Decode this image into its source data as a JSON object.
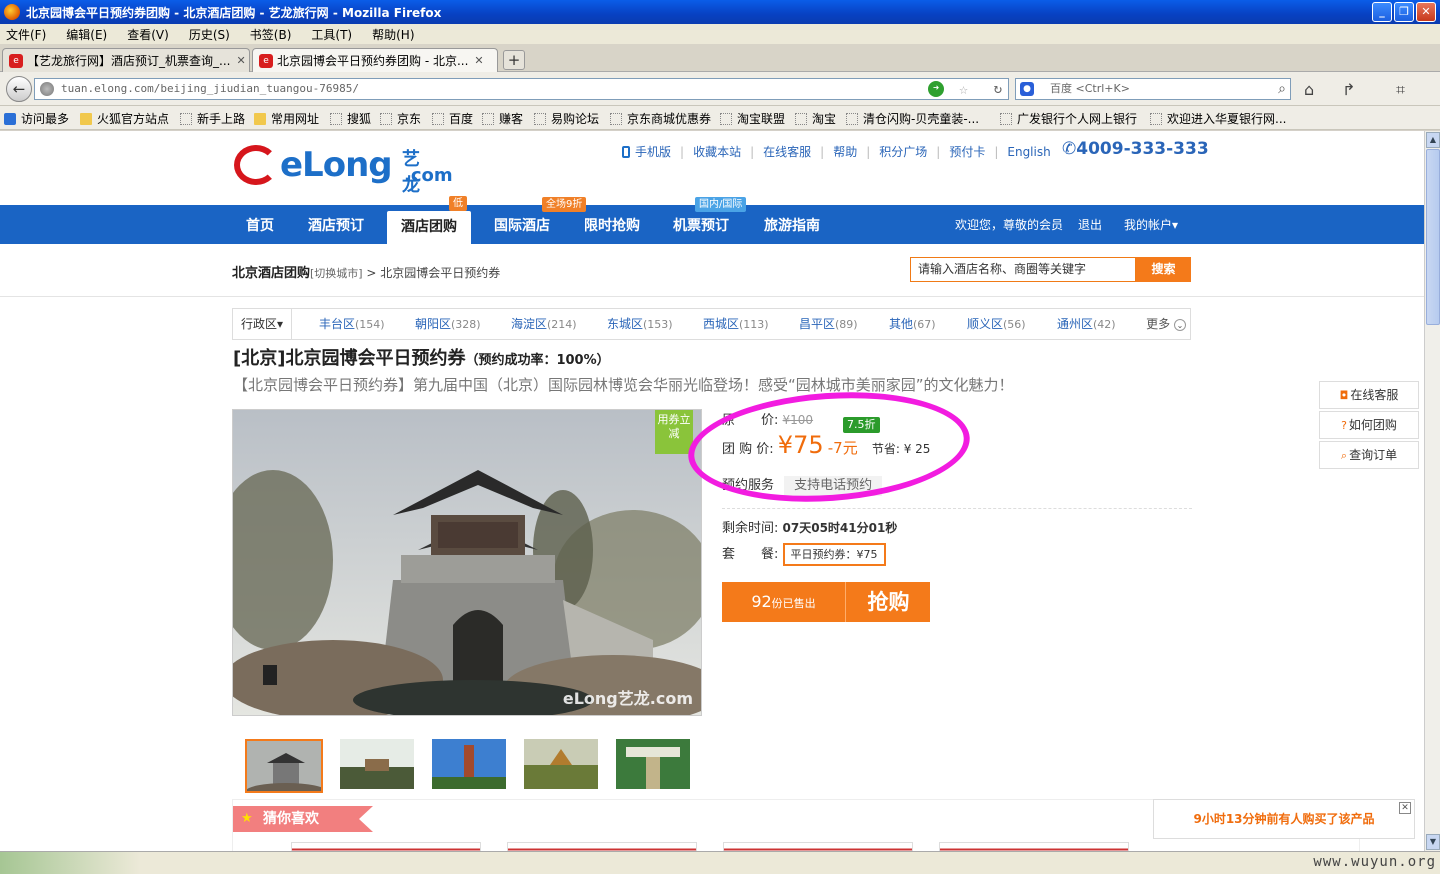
{
  "window": {
    "title": "北京园博会平日预约券团购 - 北京酒店团购 - 艺龙旅行网 - Mozilla Firefox",
    "minimize": "_",
    "restore": "❐",
    "close": "✕"
  },
  "menu": [
    "文件(F)",
    "编辑(E)",
    "查看(V)",
    "历史(S)",
    "书签(B)",
    "工具(T)",
    "帮助(H)"
  ],
  "tabs": [
    {
      "label": "【艺龙旅行网】酒店预订_机票查询_...",
      "active": false
    },
    {
      "label": "北京园博会平日预约券团购 - 北京...",
      "active": true
    }
  ],
  "tab_favicon": "e",
  "tab_close": "✕",
  "new_tab": "+",
  "address": {
    "url": "tuan.elong.com/beijing_jiudian_tuangou-76985/",
    "search_placeholder": "百度 <Ctrl+K>",
    "search_engine_icon": "paw-icon"
  },
  "bookmarks": [
    {
      "label": "访问最多",
      "icon": "blue"
    },
    {
      "label": "火狐官方站点",
      "icon": "folder"
    },
    {
      "label": "新手上路",
      "icon": "page"
    },
    {
      "label": "常用网址",
      "icon": "folder"
    },
    {
      "label": "搜狐",
      "icon": "page"
    },
    {
      "label": "京东",
      "icon": "page"
    },
    {
      "label": "百度",
      "icon": "page"
    },
    {
      "label": "赚客",
      "icon": "page"
    },
    {
      "label": "易购论坛",
      "icon": "page"
    },
    {
      "label": "京东商城优惠券",
      "icon": "page"
    },
    {
      "label": "淘宝联盟",
      "icon": "page"
    },
    {
      "label": "淘宝",
      "icon": "page"
    },
    {
      "label": "清仓闪购-贝壳童装-...",
      "icon": "page"
    },
    {
      "label": "广发银行个人网上银行",
      "icon": "page"
    },
    {
      "label": "欢迎进入华夏银行网...",
      "icon": "page"
    }
  ],
  "site": {
    "logo_text": "eLong",
    "logo_cn": "艺龙",
    "logo_com": ".com",
    "top_links": [
      "手机版",
      "收藏本站",
      "在线客服",
      "帮助",
      "积分广场",
      "预付卡",
      "English"
    ],
    "hotline": "4009-333-333",
    "nav": [
      {
        "label": "首页",
        "badge": ""
      },
      {
        "label": "酒店预订",
        "badge": ""
      },
      {
        "label": "酒店团购",
        "badge": "低",
        "active": true
      },
      {
        "label": "国际酒店",
        "badge": "全场9折"
      },
      {
        "label": "限时抢购",
        "badge": ""
      },
      {
        "label": "机票预订",
        "badge": "国内/国际"
      },
      {
        "label": "旅游指南",
        "badge": ""
      }
    ],
    "welcome": "欢迎您，尊敬的会员",
    "logout": "退出",
    "account": "我的帐户▾"
  },
  "breadcrumb": {
    "city": "北京酒店团购",
    "switch": "[切换城市]",
    "sep": " > ",
    "current": "北京园博会平日预约券"
  },
  "site_search": {
    "placeholder": "请输入酒店名称、商圈等关键字",
    "button": "搜索"
  },
  "districts": {
    "label": "行政区▾",
    "items": [
      {
        "name": "丰台区",
        "count": "(154)"
      },
      {
        "name": "朝阳区",
        "count": "(328)"
      },
      {
        "name": "海淀区",
        "count": "(214)"
      },
      {
        "name": "东城区",
        "count": "(153)"
      },
      {
        "name": "西城区",
        "count": "(113)"
      },
      {
        "name": "昌平区",
        "count": "(89)"
      },
      {
        "name": "其他",
        "count": "(67)"
      },
      {
        "name": "顺义区",
        "count": "(56)"
      },
      {
        "name": "通州区",
        "count": "(42)"
      }
    ],
    "more": "更多"
  },
  "deal": {
    "title": "[北京]北京园博会平日预约券",
    "success_rate": "（预约成功率：100%）",
    "subtitle": "【北京园博会平日预约券】第九届中国（北京）国际园林博览会华丽光临登场！感受“园林城市美丽家园”的文化魅力！",
    "flag": "用券立减",
    "photo_watermark": "eLong艺龙.com",
    "original_label": "原　　价:",
    "original_price": "¥100",
    "discount": "7.5折",
    "group_label": "团 购 价:",
    "group_price": "¥75",
    "price_diff": "-7元",
    "save_label": "节省: ¥ 25",
    "service_label": "预约服务",
    "service_value": "支持电话预约",
    "remain_label": "剩余时间:",
    "remain_value": "07天05时41分01秒",
    "package_label": "套　　餐:",
    "package_value": "平日预约券：¥75",
    "sold_count": "92",
    "sold_suffix": "份已售出",
    "buy_button": "抢购"
  },
  "side": [
    {
      "label": "在线客服",
      "icon": "chat-icon",
      "glyph": "◘"
    },
    {
      "label": "如何团购",
      "icon": "help-icon",
      "glyph": "?"
    },
    {
      "label": "查询订单",
      "icon": "search-icon",
      "glyph": "⌕"
    }
  ],
  "recommend": {
    "title": "猜你喜欢",
    "star": "★"
  },
  "notice": {
    "text": "9小时13分钟前有人购买了该产品",
    "close": "✕"
  },
  "watermark": "www.wuyun.org",
  "colors": {
    "brand_blue": "#1a64c4",
    "accent_orange": "#f47a1a",
    "price_orange": "#f06c0c",
    "annotation_pink": "#f21ce0"
  }
}
